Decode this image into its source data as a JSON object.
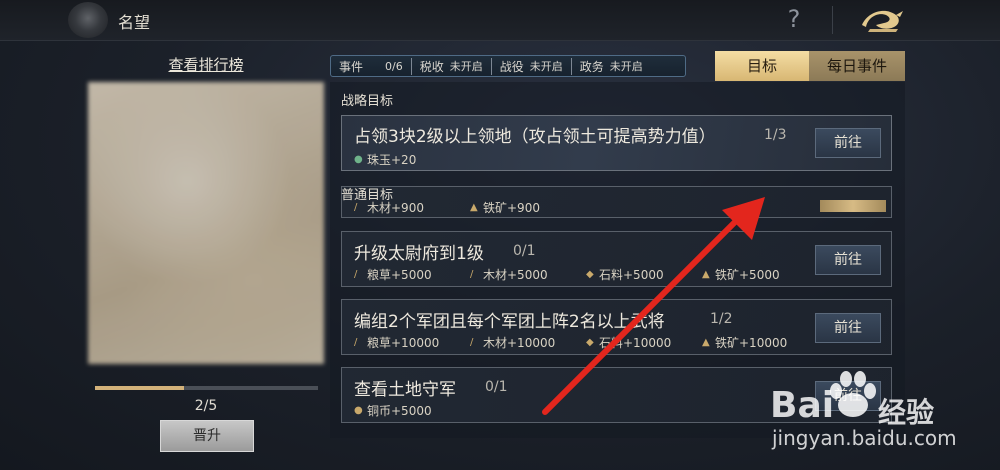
{
  "header": {
    "title": "名望",
    "help_label": "?"
  },
  "left": {
    "rank_link": "查看排行榜",
    "progress": {
      "text": "2/5",
      "fraction": 0.4
    },
    "promote_button": "晋升"
  },
  "stats": [
    {
      "label": "事件",
      "value": "0/6"
    },
    {
      "label": "税收",
      "value": "未开启"
    },
    {
      "label": "战役",
      "value": "未开启"
    },
    {
      "label": "政务",
      "value": "未开启"
    }
  ],
  "tabs": {
    "goal": "目标",
    "daily": "每日事件"
  },
  "sections": {
    "strategic": "战略目标",
    "normal": "普通目标"
  },
  "cards": [
    {
      "title": "占领3块2级以上领地（攻占领土可提高势力值）",
      "count": "1/3",
      "button": "前往",
      "rewards": [
        {
          "icon": "jade-icon",
          "text": "珠玉+20"
        }
      ]
    },
    {
      "title": "",
      "count": "",
      "button": "",
      "rewards": [
        {
          "icon": "wood-icon",
          "text": "木材+900"
        },
        {
          "icon": "iron-icon",
          "text": "铁矿+900"
        }
      ]
    },
    {
      "title": "升级太尉府到1级",
      "count": "0/1",
      "button": "前往",
      "rewards": [
        {
          "icon": "grain-icon",
          "text": "粮草+5000"
        },
        {
          "icon": "wood-icon",
          "text": "木材+5000"
        },
        {
          "icon": "stone-icon",
          "text": "石料+5000"
        },
        {
          "icon": "iron-icon",
          "text": "铁矿+5000"
        }
      ]
    },
    {
      "title": "编组2个军团且每个军团上阵2名以上武将",
      "count": "1/2",
      "button": "前往",
      "rewards": [
        {
          "icon": "grain-icon",
          "text": "粮草+10000"
        },
        {
          "icon": "wood-icon",
          "text": "木材+10000"
        },
        {
          "icon": "stone-icon",
          "text": "石料+10000"
        },
        {
          "icon": "iron-icon",
          "text": "铁矿+10000"
        }
      ]
    },
    {
      "title": "查看土地守军",
      "count": "0/1",
      "button": "前往",
      "rewards": [
        {
          "icon": "coin-icon",
          "text": "铜币+5000"
        }
      ]
    }
  ],
  "watermark": {
    "brand": "Bai",
    "brand_cn": "经验",
    "url": "jingyan.baidu.com"
  },
  "colors": {
    "accent_gold": "#d8b773",
    "arrow_red": "#e3261d"
  }
}
